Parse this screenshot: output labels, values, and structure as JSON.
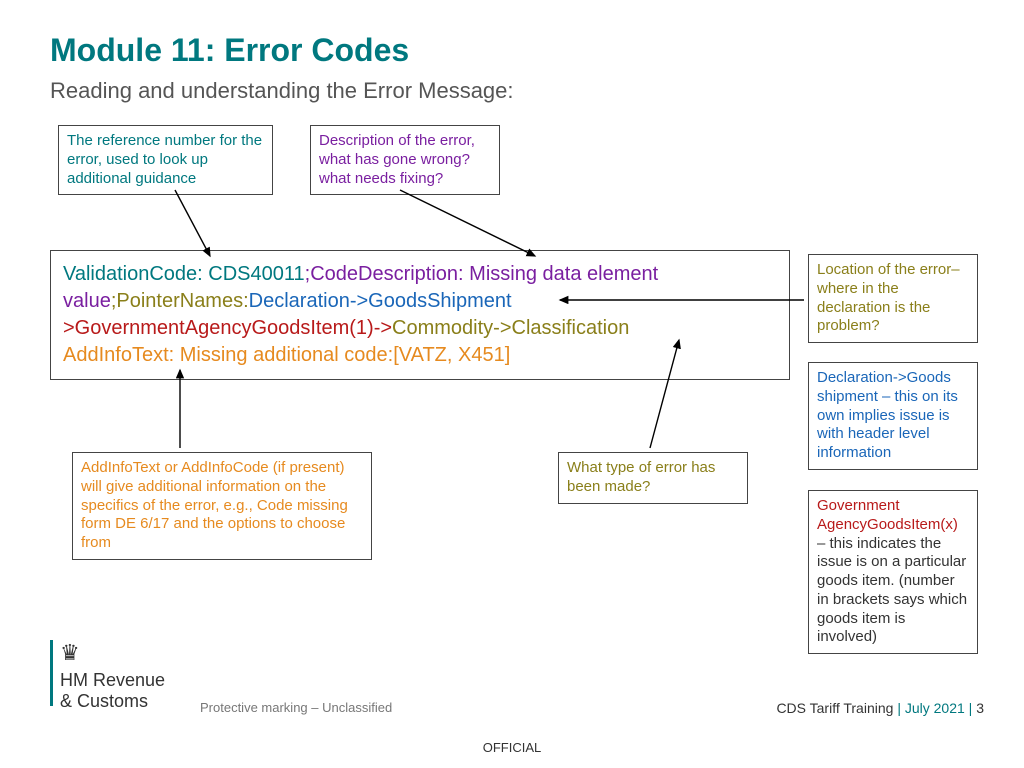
{
  "title": "Module 11: Error Codes",
  "subtitle": "Reading and understanding the Error Message:",
  "callouts": {
    "reference": "The reference number for the error, used to look up additional guidance",
    "description": "Description of the error, what has gone wrong? what needs fixing?",
    "location": "Location of the error– where in the declaration is the problem?",
    "declaration": "Declaration->Goods shipment – this on its own implies issue is with header level information",
    "government_prefix": "Government AgencyGoodsItem(x)",
    "government_rest": " – this indicates the issue is on a particular goods item. (number in brackets says which goods item is involved)",
    "addinfo": "AddInfoText or AddInfoCode (if present) will give additional information on the specifics of the error, e.g., Code missing form DE 6/17 and the options to choose from",
    "whattype": "What type of error has been made?"
  },
  "error": {
    "validationCodeLabel": "ValidationCode: CDS40011",
    "sep1": ";",
    "codeDescription": "CodeDescription: Missing data element value",
    "sep2": ";",
    "pointerNamesLabel": "PointerNames:",
    "declgoods": "Declaration->GoodsShipment",
    "gov": ">GovernmentAgencyGoodsItem(1)->",
    "commodity": "Commodity->Classification",
    "addinfo": "AddInfoText: Missing additional code:[VATZ, X451]"
  },
  "footer": {
    "org1": "HM Revenue",
    "org2": "& Customs",
    "marking": "Protective marking – Unclassified",
    "training": "CDS Tariff Training",
    "sep": " | ",
    "date": "July 2021",
    "page": "3",
    "official": "OFFICIAL"
  }
}
